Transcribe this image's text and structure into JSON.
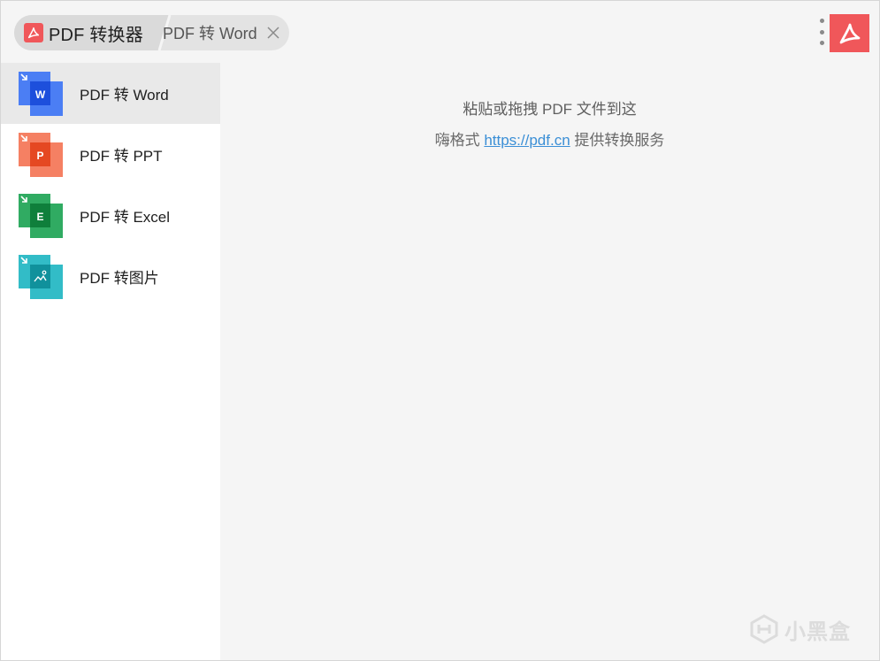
{
  "header": {
    "app_name": "PDF 转换器",
    "current_tab": "PDF 转 Word"
  },
  "sidebar": {
    "items": [
      {
        "label": "PDF 转 Word",
        "icon_letter": "W",
        "active": true
      },
      {
        "label": "PDF 转 PPT",
        "icon_letter": "P",
        "active": false
      },
      {
        "label": "PDF 转 Excel",
        "icon_letter": "E",
        "active": false
      },
      {
        "label": "PDF 转图片",
        "icon_letter": "",
        "active": false
      }
    ]
  },
  "main": {
    "drop_hint": "粘贴或拖拽 PDF 文件到这",
    "credit_prefix": "嗨格式",
    "credit_link": "https://pdf.cn",
    "credit_suffix": "提供转换服务"
  },
  "watermark": {
    "text": "小黑盒"
  },
  "colors": {
    "brand": "#f0575a",
    "word": "#2f6bf6",
    "ppt": "#f2603c",
    "excel": "#1aa251",
    "image": "#1cb5c1",
    "link": "#3b8fd6"
  },
  "icons": {
    "app_logo": "acrobat-icon",
    "close": "close-icon",
    "menu": "more-vertical-icon",
    "brand": "acrobat-icon",
    "word": "word-doc-icon",
    "ppt": "ppt-doc-icon",
    "excel": "excel-doc-icon",
    "image": "image-doc-icon"
  }
}
